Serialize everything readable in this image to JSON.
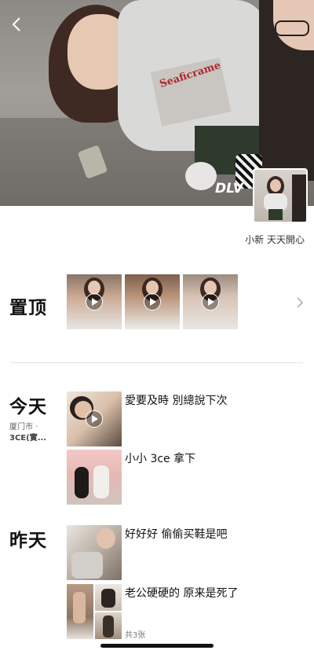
{
  "header": {
    "nickname": "小新 天天開心",
    "cover_watermark": "DLV",
    "shirt_print": "Seaficrame"
  },
  "pinned": {
    "title": "置顶",
    "item_count": 3
  },
  "today": {
    "title": "今天",
    "location_line1": "厦门市 ·",
    "location_line2": "3CE(實...",
    "posts": [
      {
        "text": "愛要及時 別總說下次"
      },
      {
        "text": "小小 3ce 拿下"
      }
    ]
  },
  "yesterday": {
    "title": "昨天",
    "posts": [
      {
        "text": "好好好 偷偷买鞋是吧"
      },
      {
        "text": "老公硬硬的 原来是死了",
        "photo_count": "共3张"
      }
    ]
  },
  "icons": {
    "back": "chevron-left-icon",
    "more": "chevron-right-icon",
    "play": "play-icon"
  },
  "colors": {
    "text": "#111111",
    "muted": "#777777",
    "divider": "#e6e6e6"
  }
}
